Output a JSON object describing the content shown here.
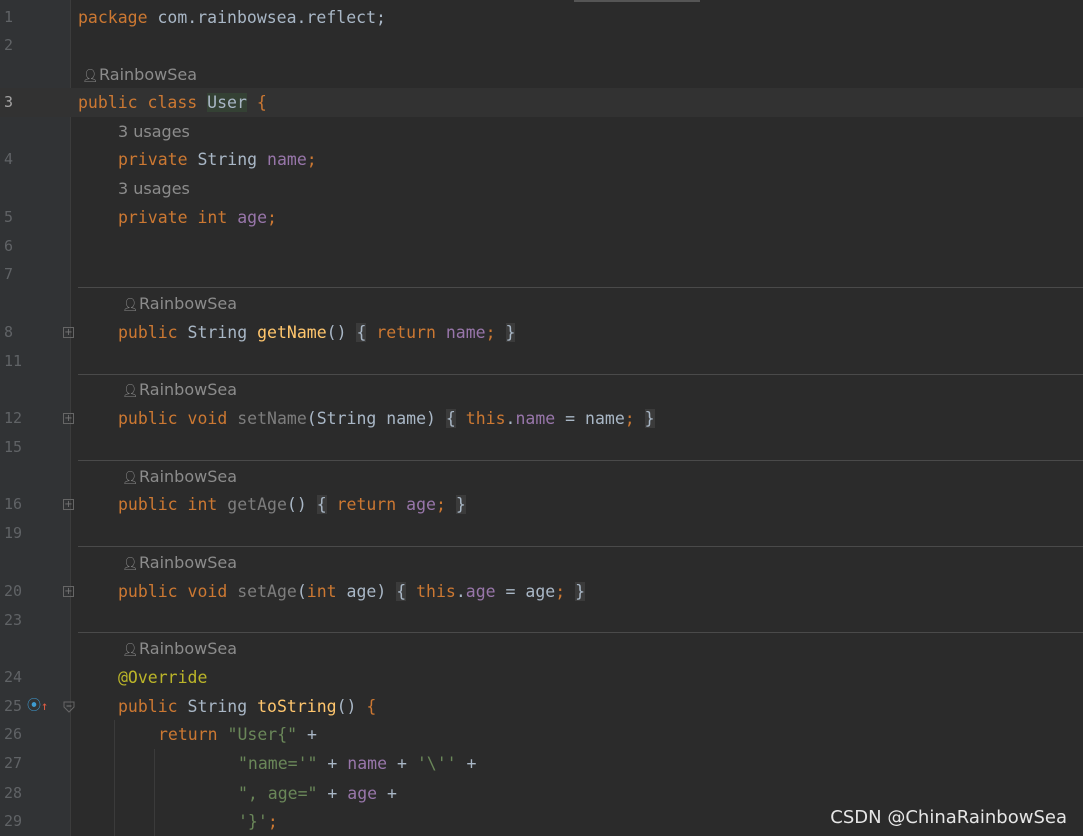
{
  "author": "RainbowSea",
  "usages": "3 usages",
  "lines": {
    "l1": "1",
    "l2": "2",
    "l3": "3",
    "l4": "4",
    "l5": "5",
    "l6": "6",
    "l7": "7",
    "l8": "8",
    "l11": "11",
    "l12": "12",
    "l15": "15",
    "l16": "16",
    "l19": "19",
    "l20": "20",
    "l23": "23",
    "l24": "24",
    "l25": "25",
    "l26": "26",
    "l27": "27",
    "l28": "28",
    "l29": "29"
  },
  "code": {
    "pkg_kw": "package",
    "pkg_name": " com.rainbowsea.reflect;",
    "public": "public",
    "private": "private",
    "class": "class",
    "void": "void",
    "int": "int",
    "return": "return",
    "this": "this",
    "class_name": "User",
    "open_brace": " {",
    "open_brace_box": "{",
    "close_brace": "}",
    "string_type": "String",
    "name": "name",
    "age": "age",
    "semi": ";",
    "getName": "getName",
    "setName": "setName",
    "getAge": "getAge",
    "setAge": "setAge",
    "toString": "toString",
    "paren_empty": "()",
    "paren_open": "(",
    "paren_close": ")",
    "override": "@Override",
    "str_user": "\"User{\"",
    "str_name": "\"name='\"",
    "str_quote": "'\\''",
    "str_age": "\", age=\"",
    "str_close": "'}'",
    "plus": " + ",
    "eq": " = ",
    "dot": "."
  },
  "watermark": "CSDN @ChinaRainbowSea",
  "colors": {
    "background": "#2b2b2b",
    "keyword": "#cc7832",
    "function": "#ffc66d",
    "field": "#9876aa",
    "string": "#6a8759",
    "annotation": "#bbb529",
    "text": "#a9b7c6"
  },
  "icons": [
    "person-icon",
    "fold-plus-icon",
    "fold-minus-icon",
    "override-marker-icon"
  ]
}
